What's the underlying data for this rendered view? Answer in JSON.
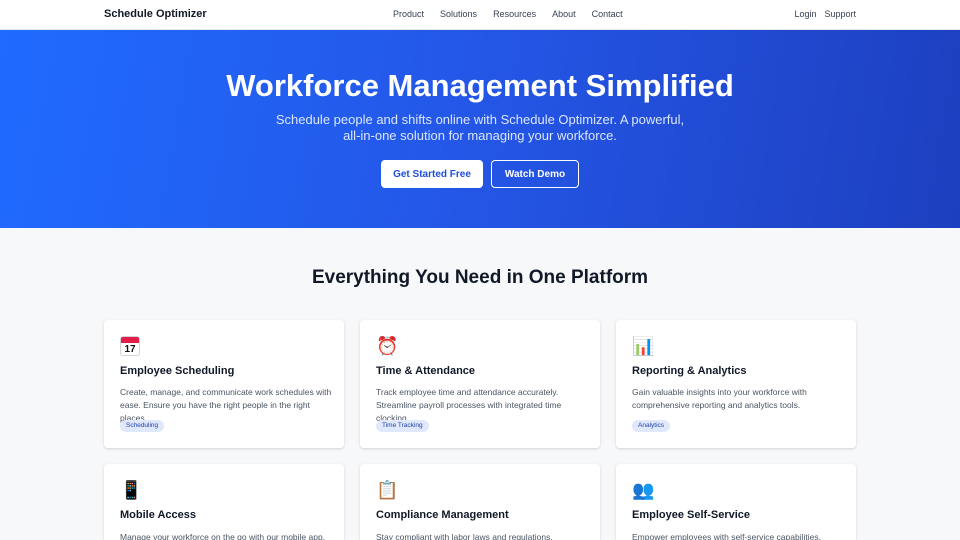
{
  "nav": {
    "brand": "Schedule Optimizer",
    "links": [
      "Product",
      "Solutions",
      "Resources",
      "About",
      "Contact"
    ],
    "right": [
      "Login",
      "Support"
    ]
  },
  "hero": {
    "title": "Workforce Management Simplified",
    "subtitle_line1": "Schedule people and shifts online with Schedule Optimizer. A powerful,",
    "subtitle_line2": "all-in-one solution for managing your workforce.",
    "primary_cta": "Get Started Free",
    "secondary_cta": "Watch Demo"
  },
  "features": {
    "title": "Everything You Need in One Platform",
    "cards": [
      {
        "icon": "calendar-icon",
        "icon_glyph": "17",
        "title": "Employee Scheduling",
        "description": "Create, manage, and communicate work schedules with ease. Ensure you have the right people in the right places.",
        "tag": "Scheduling"
      },
      {
        "icon": "alarm-clock-icon",
        "icon_glyph": "⏰",
        "title": "Time & Attendance",
        "description": "Track employee time and attendance accurately. Streamline payroll processes with integrated time clocking.",
        "tag": "Time Tracking"
      },
      {
        "icon": "bar-chart-icon",
        "icon_glyph": "📊",
        "title": "Reporting & Analytics",
        "description": "Gain valuable insights into your workforce with comprehensive reporting and analytics tools.",
        "tag": "Analytics"
      },
      {
        "icon": "mobile-phone-icon",
        "icon_glyph": "📱",
        "title": "Mobile Access",
        "description": "Manage your workforce on the go with our mobile app.",
        "tag": ""
      },
      {
        "icon": "clipboard-icon",
        "icon_glyph": "📋",
        "title": "Compliance Management",
        "description": "Stay compliant with labor laws and regulations. Automated",
        "tag": ""
      },
      {
        "icon": "people-icon",
        "icon_glyph": "👥",
        "title": "Employee Self-Service",
        "description": "Empower employees with self-service capabilities.",
        "tag": ""
      }
    ]
  }
}
